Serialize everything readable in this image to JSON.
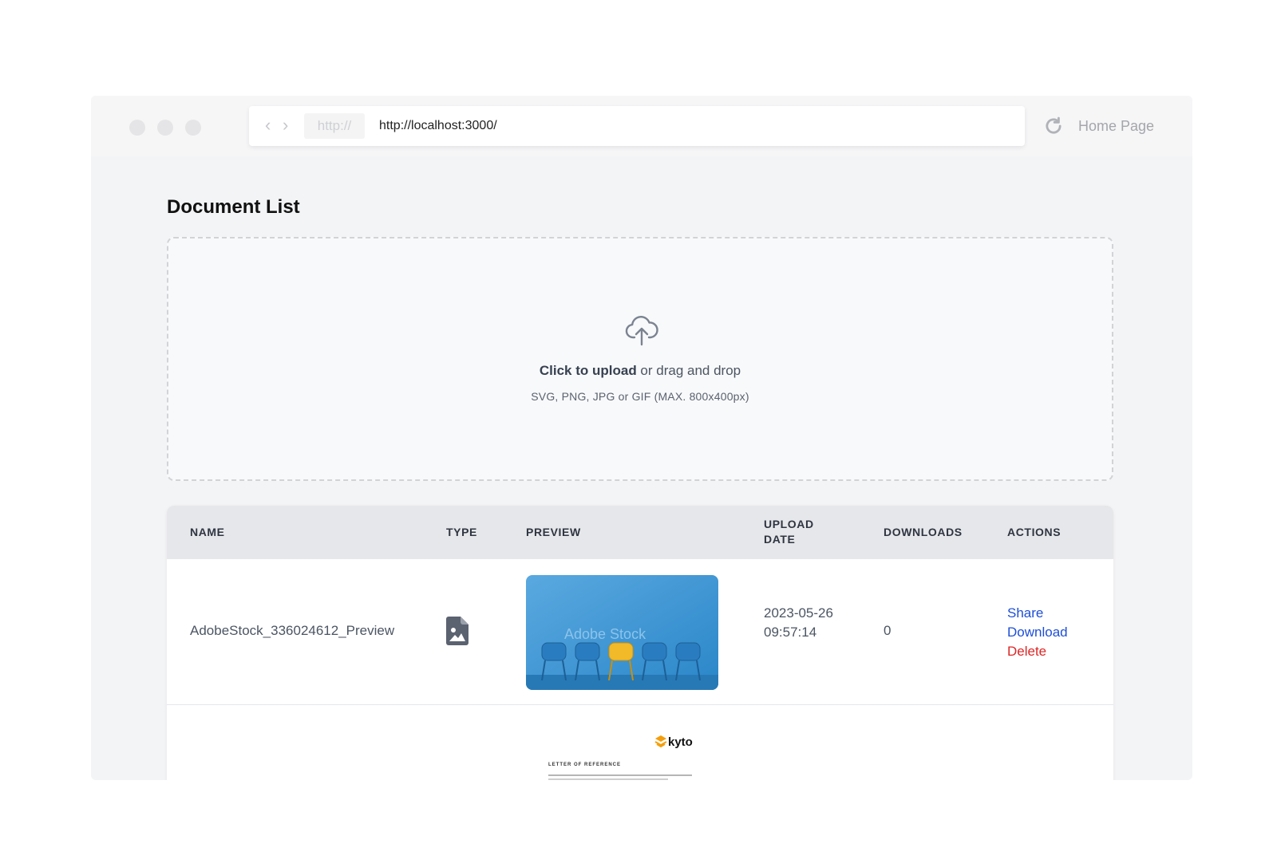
{
  "browser": {
    "scheme": "http://",
    "url": "http://localhost:3000/",
    "home_label": "Home Page"
  },
  "page": {
    "title": "Document List"
  },
  "upload": {
    "primary_bold": "Click to upload",
    "primary_rest": " or drag and drop",
    "hint": "SVG, PNG, JPG or GIF (MAX. 800x400px)"
  },
  "table": {
    "headers": {
      "name": "NAME",
      "type": "TYPE",
      "preview": "PREVIEW",
      "upload_date": "UPLOAD DATE",
      "downloads": "DOWNLOADS",
      "actions": "ACTIONS"
    },
    "rows": [
      {
        "name": "AdobeStock_336024612_Preview",
        "type_icon": "image-file-icon",
        "preview_watermark": "Adobe Stock",
        "upload_date": "2023-05-26 09:57:14",
        "downloads": "0",
        "actions": {
          "share": "Share",
          "download": "Download",
          "delete": "Delete"
        }
      },
      {
        "preview_logo": "kyto",
        "preview_heading": "LETTER OF REFERENCE"
      }
    ]
  },
  "colors": {
    "link": "#1d4ed8",
    "danger": "#dc2626",
    "kyto_orange": "#f59e0b"
  }
}
